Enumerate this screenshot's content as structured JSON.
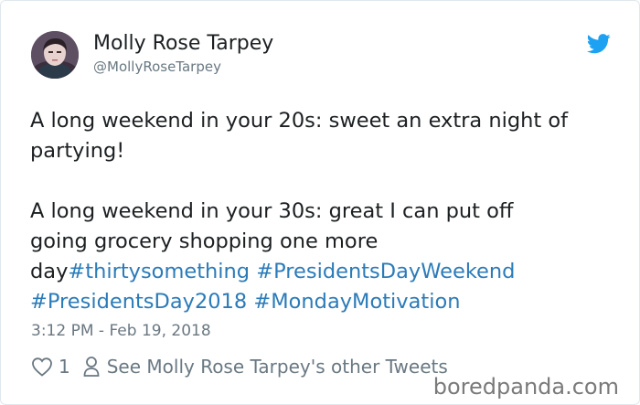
{
  "author": {
    "display_name": "Molly Rose Tarpey",
    "handle": "@MollyRoseTarpey",
    "avatar": "profile-photo"
  },
  "tweet": {
    "lines": [
      [
        {
          "text": "A long weekend in your 20s: sweet an extra night of",
          "type": "text"
        }
      ],
      [
        {
          "text": "partying!",
          "type": "text"
        }
      ],
      [],
      [
        {
          "text": "A long weekend in your 30s: great I can put off",
          "type": "text"
        }
      ],
      [
        {
          "text": "going grocery shopping one more",
          "type": "text"
        }
      ],
      [
        {
          "text": "day",
          "type": "text"
        },
        {
          "text": "#thirtysomething",
          "type": "hashtag"
        },
        {
          "text": " ",
          "type": "text"
        },
        {
          "text": "#PresidentsDayWeekend",
          "type": "hashtag"
        }
      ],
      [
        {
          "text": "#PresidentsDay2018",
          "type": "hashtag"
        },
        {
          "text": " ",
          "type": "text"
        },
        {
          "text": "#MondayMotivation",
          "type": "hashtag"
        }
      ]
    ],
    "timestamp": "3:12 PM - Feb 19, 2018"
  },
  "actions": {
    "like_count": "1",
    "other_tweets_label": "See Molly Rose Tarpey's other Tweets"
  },
  "watermark": "boredpanda.com",
  "colors": {
    "hashtag": "#2b7bb9",
    "twitter_blue": "#1da1f2",
    "meta_gray": "#697882",
    "text": "#1c2022"
  },
  "icons": {
    "brand": "twitter-bird-icon",
    "like": "heart-outline-icon",
    "profile": "person-outline-icon"
  }
}
